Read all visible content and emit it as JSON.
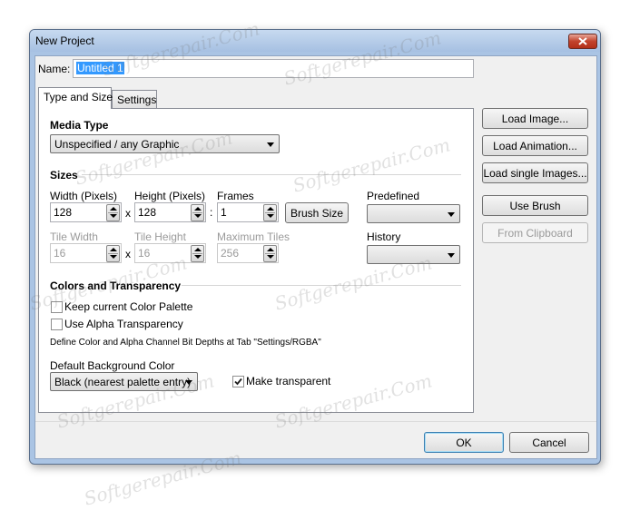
{
  "window": {
    "title": "New Project"
  },
  "name": {
    "label": "Name:",
    "value": "Untitled 1"
  },
  "tabs": [
    {
      "label": "Type and Size",
      "active": true
    },
    {
      "label": "Settings",
      "active": false
    }
  ],
  "media_type": {
    "title": "Media Type",
    "selected": "Unspecified / any Graphic"
  },
  "sizes": {
    "title": "Sizes",
    "width_label": "Width (Pixels)",
    "width_value": "128",
    "height_label": "Height (Pixels)",
    "height_value": "128",
    "frames_label": "Frames",
    "frames_value": "1",
    "x_sep": "x",
    "colon_sep": ":",
    "brush_size_label": "Brush Size",
    "predefined_label": "Predefined",
    "predefined_value": "",
    "tile_width_label": "Tile Width",
    "tile_width_value": "16",
    "tile_height_label": "Tile Height",
    "tile_height_value": "16",
    "max_tiles_label": "Maximum Tiles",
    "max_tiles_value": "256",
    "history_label": "History",
    "history_value": ""
  },
  "colors": {
    "title": "Colors and Transparency",
    "keep_palette_label": "Keep current Color Palette",
    "keep_palette_checked": false,
    "alpha_label": "Use Alpha Transparency",
    "alpha_checked": false,
    "note": "Define Color and Alpha Channel Bit Depths at Tab \"Settings/RGBA\"",
    "bg_label": "Default Background Color",
    "bg_value": "Black (nearest palette entry)",
    "make_transparent_label": "Make transparent",
    "make_transparent_checked": true
  },
  "side_buttons": {
    "load_image": "Load Image...",
    "load_animation": "Load Animation...",
    "load_single_images": "Load single Images...",
    "use_brush": "Use Brush",
    "from_clipboard": "From Clipboard"
  },
  "footer": {
    "ok": "OK",
    "cancel": "Cancel"
  },
  "watermark": {
    "text": "Softgerepair.Com"
  },
  "icons": {
    "close": "close-icon",
    "check": "checkmark-icon"
  },
  "colors_accent": {
    "title_bar": "#aac4e4",
    "close_button": "#c2432c",
    "selection": "#3399ff"
  }
}
